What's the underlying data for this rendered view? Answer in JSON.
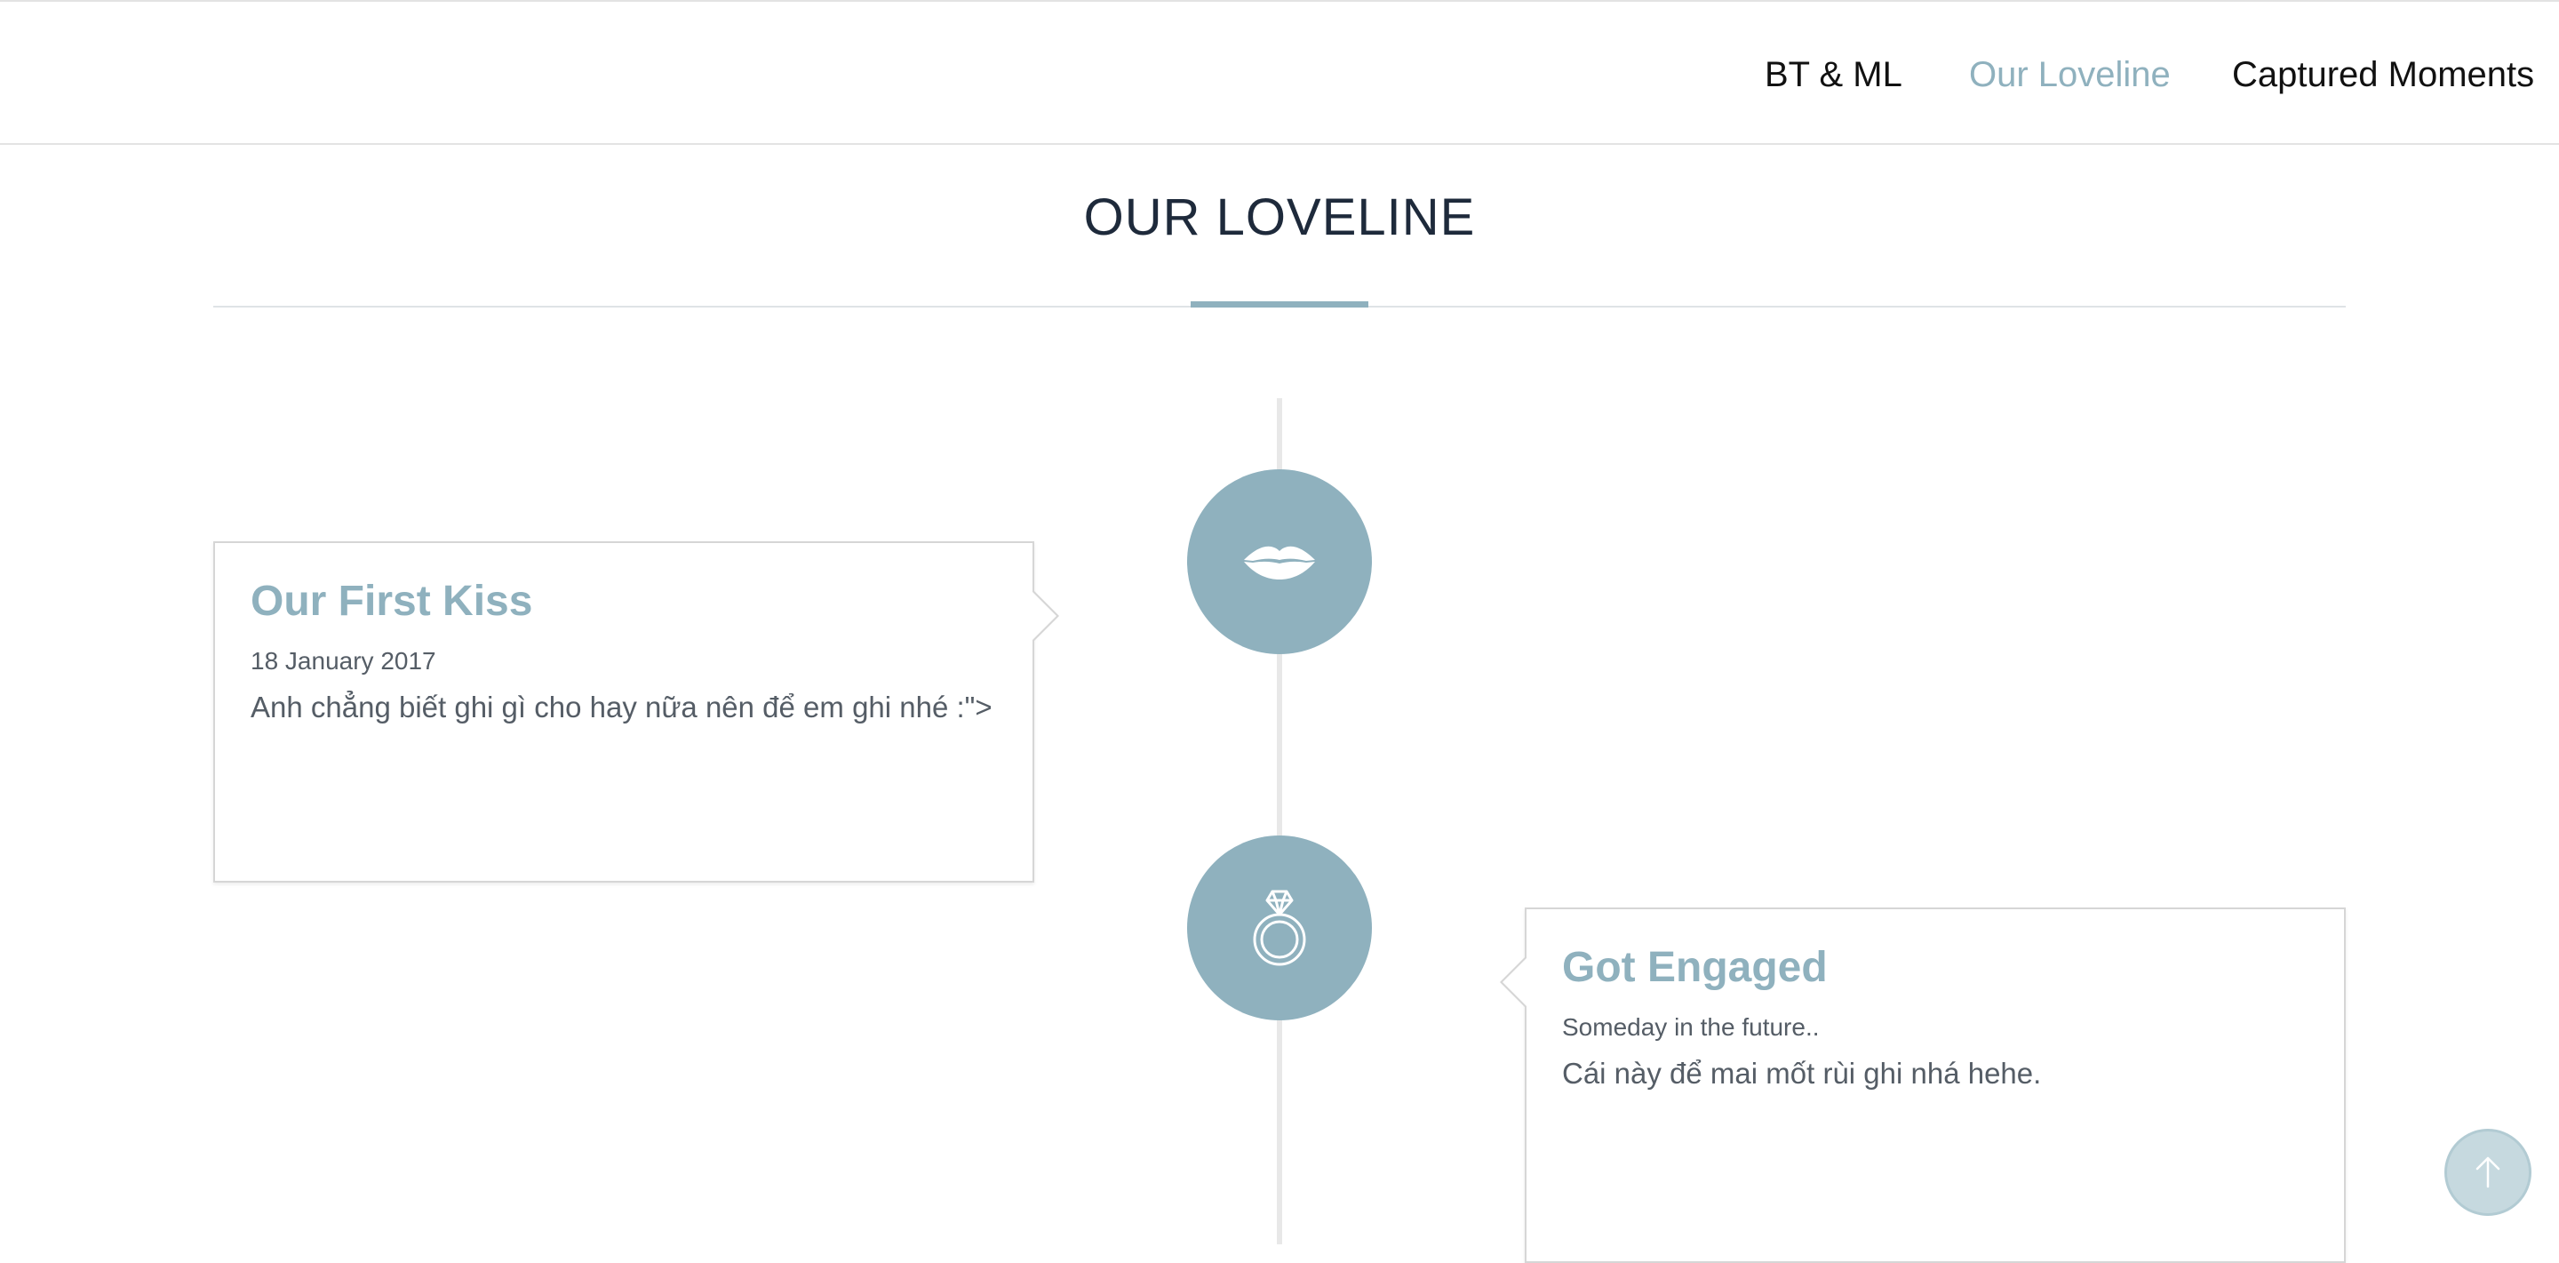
{
  "nav": {
    "items": [
      {
        "label": "BT & ML",
        "active": false
      },
      {
        "label": "Our Loveline",
        "active": true
      },
      {
        "label": "Captured Moments",
        "active": false
      }
    ]
  },
  "section": {
    "title": "OUR LOVELINE"
  },
  "timeline": {
    "events": [
      {
        "icon": "lips-icon",
        "side": "left",
        "title": "Our First Kiss",
        "date": "18 January 2017",
        "text": "Anh chẳng biết ghi gì cho hay nữa nên để em ghi nhé :\">"
      },
      {
        "icon": "ring-icon",
        "side": "right",
        "title": "Got Engaged",
        "date": "Someday in the future..",
        "text": "Cái này để mai mốt rùi ghi nhá hehe."
      }
    ]
  },
  "back_to_top": {
    "icon": "arrow-up-icon"
  },
  "colors": {
    "accent": "#8fb1be",
    "title": "#1e2a3b",
    "body_text": "#555d66",
    "timeline_line": "#e8e8e8"
  }
}
